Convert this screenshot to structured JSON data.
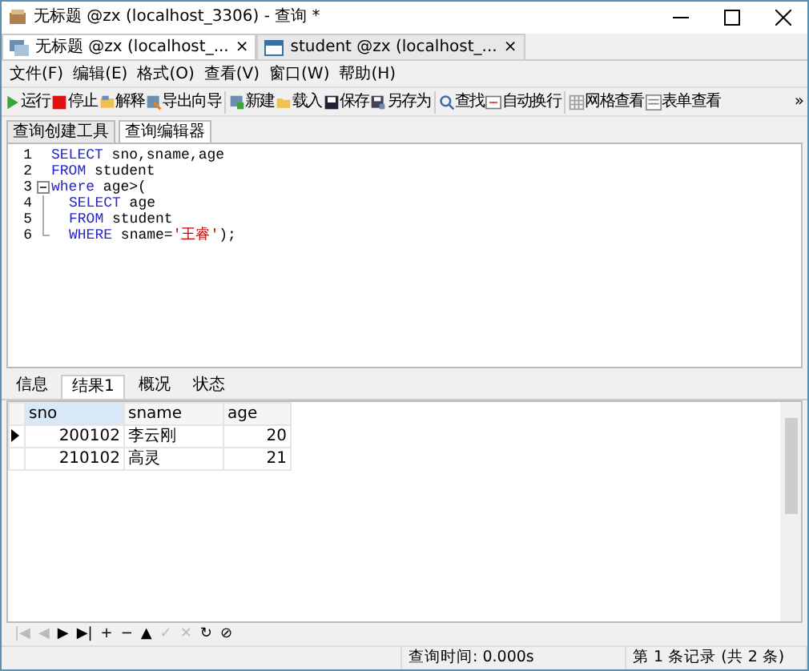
{
  "window": {
    "title": "无标题 @zx (localhost_3306) - 查询 *"
  },
  "doc_tabs": [
    {
      "label": "无标题 @zx (localhost_...",
      "selected": true,
      "close": "×"
    },
    {
      "label": "student @zx (localhost_...",
      "selected": false,
      "close": "×"
    }
  ],
  "menu": [
    "文件(F)",
    "编辑(E)",
    "格式(O)",
    "查看(V)",
    "窗口(W)",
    "帮助(H)"
  ],
  "toolbar": [
    [
      {
        "label": "运行"
      },
      {
        "label": "停止"
      },
      {
        "label": "解释"
      },
      {
        "label": "导出向导"
      }
    ],
    [
      {
        "label": "新建"
      },
      {
        "label": "载入"
      },
      {
        "label": "保存"
      },
      {
        "label": "另存为"
      }
    ],
    [
      {
        "label": "查找"
      },
      {
        "label": "自动换行"
      }
    ],
    [
      {
        "label": "网格查看"
      },
      {
        "label": "表单查看"
      }
    ]
  ],
  "toolbar_overflow": "»",
  "sub_tabs": [
    {
      "label": "查询创建工具",
      "selected": false
    },
    {
      "label": "查询编辑器",
      "selected": true
    }
  ],
  "editor": {
    "lines": [
      {
        "number": "1",
        "kind": "plain",
        "indented": false,
        "segments": [
          {
            "kind": "keyword",
            "text": "SELECT"
          },
          {
            "kind": "plain",
            "text": " sno,sname,age"
          }
        ]
      },
      {
        "number": "2",
        "kind": "plain",
        "indented": false,
        "segments": [
          {
            "kind": "keyword",
            "text": "FROM"
          },
          {
            "kind": "plain",
            "text": " student"
          }
        ]
      },
      {
        "number": "3",
        "kind": "fold-start",
        "indented": false,
        "segments": [
          {
            "kind": "keyword",
            "text": "where"
          },
          {
            "kind": "plain",
            "text": " age>("
          }
        ]
      },
      {
        "number": "4",
        "kind": "fold-inner",
        "indented": true,
        "segments": [
          {
            "kind": "keyword",
            "text": "SELECT"
          },
          {
            "kind": "plain",
            "text": " age"
          }
        ]
      },
      {
        "number": "5",
        "kind": "fold-inner",
        "indented": true,
        "segments": [
          {
            "kind": "keyword",
            "text": "FROM"
          },
          {
            "kind": "plain",
            "text": " student"
          }
        ]
      },
      {
        "number": "6",
        "kind": "fold-end",
        "indented": true,
        "segments": [
          {
            "kind": "keyword",
            "text": "WHERE"
          },
          {
            "kind": "plain",
            "text": " sname="
          },
          {
            "kind": "string",
            "text": "'王睿'"
          },
          {
            "kind": "plain",
            "text": ");"
          }
        ]
      }
    ]
  },
  "result_tabs": [
    {
      "label": "信息",
      "selected": false
    },
    {
      "label": "结果1",
      "selected": true
    },
    {
      "label": "概况",
      "selected": false
    },
    {
      "label": "状态",
      "selected": false
    }
  ],
  "table": {
    "columns": [
      "sno",
      "sname",
      "age"
    ],
    "rows": [
      {
        "current": true,
        "cells": [
          "200102",
          "李云刚",
          "20"
        ]
      },
      {
        "current": false,
        "cells": [
          "210102",
          "高灵",
          "21"
        ]
      }
    ]
  },
  "nav_buttons": [
    {
      "glyph": "|◀",
      "disabled": true
    },
    {
      "glyph": "◀",
      "disabled": true
    },
    {
      "glyph": "▶",
      "disabled": false
    },
    {
      "glyph": "▶|",
      "disabled": false
    },
    {
      "glyph": "+",
      "disabled": false
    },
    {
      "glyph": "−",
      "disabled": false
    },
    {
      "glyph": "▲",
      "disabled": false
    },
    {
      "glyph": "✓",
      "disabled": true
    },
    {
      "glyph": "✕",
      "disabled": true
    },
    {
      "glyph": "↻",
      "disabled": false
    },
    {
      "glyph": "⊘",
      "disabled": false
    }
  ],
  "status_bar": [
    "查询时间: 0.000s",
    "第 1 条记录 (共 2 条)"
  ]
}
